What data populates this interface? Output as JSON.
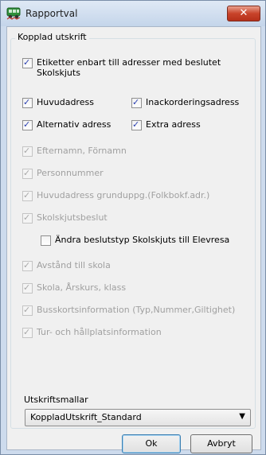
{
  "window": {
    "title": "Rapportval",
    "close_symbol": "✕"
  },
  "group": {
    "title": "Kopplad utskrift",
    "items": [
      {
        "label_line1": "Etiketter enbart till adresser med beslutet",
        "label_line2": "Skolskjuts",
        "checked": true,
        "enabled": true
      },
      {
        "label": "Huvudadress",
        "checked": true,
        "enabled": true
      },
      {
        "label": "Inackorderingsadress",
        "checked": true,
        "enabled": true
      },
      {
        "label": "Alternativ adress",
        "checked": true,
        "enabled": true
      },
      {
        "label": "Extra adress",
        "checked": true,
        "enabled": true
      },
      {
        "label": "Efternamn, Förnamn",
        "checked": true,
        "enabled": false
      },
      {
        "label": "Personnummer",
        "checked": true,
        "enabled": false
      },
      {
        "label": "Huvudadress grunduppg.(Folkbokf.adr.)",
        "checked": true,
        "enabled": false
      },
      {
        "label": "Skolskjutsbeslut",
        "checked": true,
        "enabled": false
      },
      {
        "label": "Ändra beslutstyp Skolskjuts till Elevresa",
        "checked": false,
        "enabled": true
      },
      {
        "label": "Avstånd till skola",
        "checked": true,
        "enabled": false
      },
      {
        "label": "Skola, Årskurs, klass",
        "checked": true,
        "enabled": false
      },
      {
        "label": "Busskortsinformation (Typ,Nummer,Giltighet)",
        "checked": true,
        "enabled": false
      },
      {
        "label": "Tur- och hållplatsinformation",
        "checked": true,
        "enabled": false
      }
    ]
  },
  "template": {
    "label": "Utskriftsmallar",
    "selected": "KoppladUtskrift_Standard",
    "arrow": "▼"
  },
  "buttons": {
    "ok": "Ok",
    "cancel": "Avbryt"
  }
}
